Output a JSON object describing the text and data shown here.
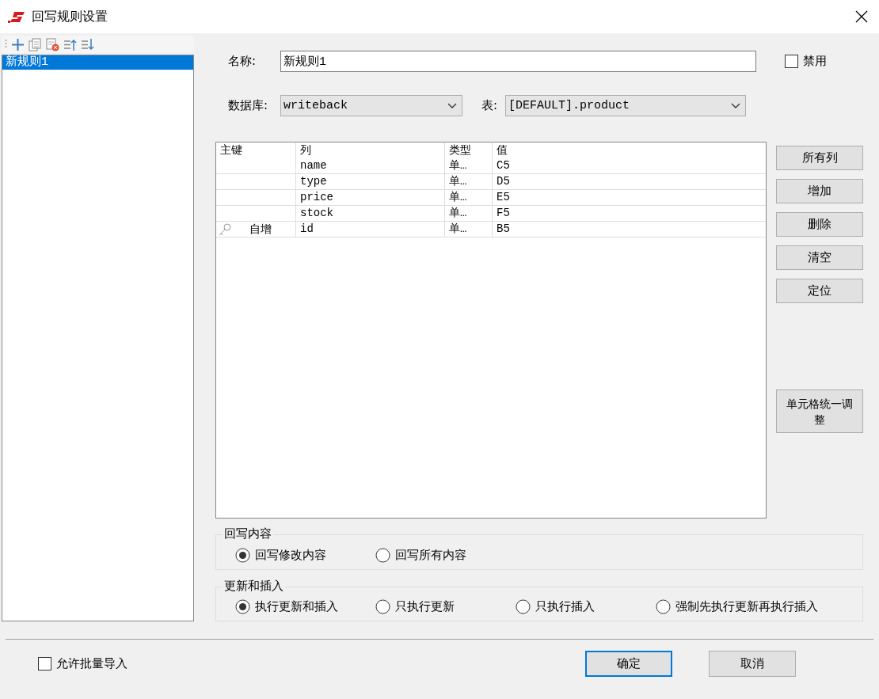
{
  "window": {
    "title": "回写规则设置"
  },
  "rules": [
    {
      "label": "新规则1",
      "selected": true
    }
  ],
  "form": {
    "name_label": "名称:",
    "name_value": "新规则1",
    "disable": {
      "label": "禁用",
      "checked": false
    },
    "database_label": "数据库:",
    "database_value": "writeback",
    "table_label": "表:",
    "table_value": "[DEFAULT].product"
  },
  "grid": {
    "columns": [
      "主键",
      "列",
      "类型",
      "值"
    ],
    "rows": [
      {
        "primary_key": false,
        "column": "name",
        "type": "单…",
        "value": "C5"
      },
      {
        "primary_key": false,
        "column": "type",
        "type": "单…",
        "value": "D5"
      },
      {
        "primary_key": false,
        "column": "price",
        "type": "单…",
        "value": "E5"
      },
      {
        "primary_key": false,
        "column": "stock",
        "type": "单…",
        "value": "F5"
      },
      {
        "primary_key": true,
        "key_note": "自增",
        "column": "id",
        "type": "单…",
        "value": "B5"
      }
    ]
  },
  "side_buttons": [
    "所有列",
    "增加",
    "删除",
    "清空",
    "定位"
  ],
  "adjust_button": "单元格统一调整",
  "groups": [
    {
      "title": "回写内容",
      "options": [
        {
          "label": "回写修改内容",
          "selected": true
        },
        {
          "label": "回写所有内容",
          "selected": false
        }
      ]
    },
    {
      "title": "更新和插入",
      "options": [
        {
          "label": "执行更新和插入",
          "selected": true
        },
        {
          "label": "只执行更新",
          "selected": false
        },
        {
          "label": "只执行插入",
          "selected": false
        },
        {
          "label": "强制先执行更新再执行插入",
          "selected": false
        }
      ]
    }
  ],
  "footer": {
    "batch_import": {
      "label": "允许批量导入",
      "checked": false
    },
    "buttons": [
      {
        "label": "确定",
        "default": true
      },
      {
        "label": "取消",
        "default": false
      }
    ]
  }
}
